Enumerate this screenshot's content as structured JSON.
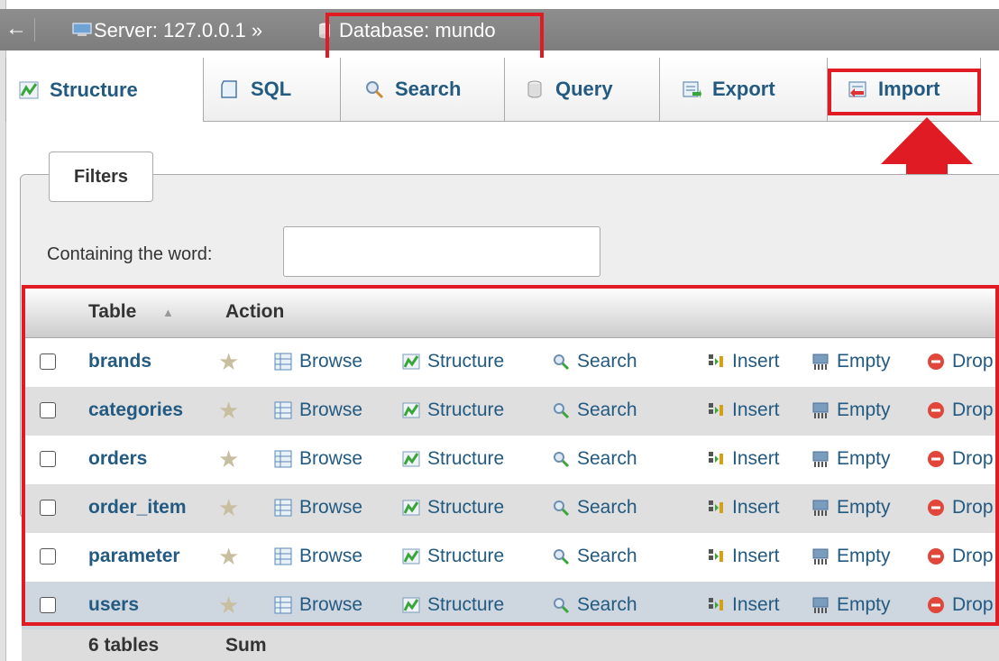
{
  "breadcrumb": {
    "back": "←",
    "server": "Server: 127.0.0.1 »",
    "database": "Database: mundo"
  },
  "tabs": [
    {
      "label": "Structure",
      "icon": "structure-icon"
    },
    {
      "label": "SQL",
      "icon": "sql-icon"
    },
    {
      "label": "Search",
      "icon": "search-icon"
    },
    {
      "label": "Query",
      "icon": "query-icon"
    },
    {
      "label": "Export",
      "icon": "export-icon"
    },
    {
      "label": "Import",
      "icon": "import-icon"
    }
  ],
  "filters": {
    "legend": "Filters",
    "label": "Containing the word:",
    "value": ""
  },
  "table": {
    "headers": {
      "table": "Table",
      "sort": "▲",
      "action": "Action"
    },
    "actions": [
      "Browse",
      "Structure",
      "Search",
      "Insert",
      "Empty",
      "Drop"
    ],
    "rows": [
      {
        "name": "brands"
      },
      {
        "name": "categories"
      },
      {
        "name": "orders"
      },
      {
        "name": "order_item"
      },
      {
        "name": "parameter"
      },
      {
        "name": "users"
      }
    ],
    "footer": {
      "count": "6 tables",
      "sum": "Sum"
    }
  },
  "colors": {
    "accent": "#235a81",
    "highlight": "#e01b24"
  }
}
